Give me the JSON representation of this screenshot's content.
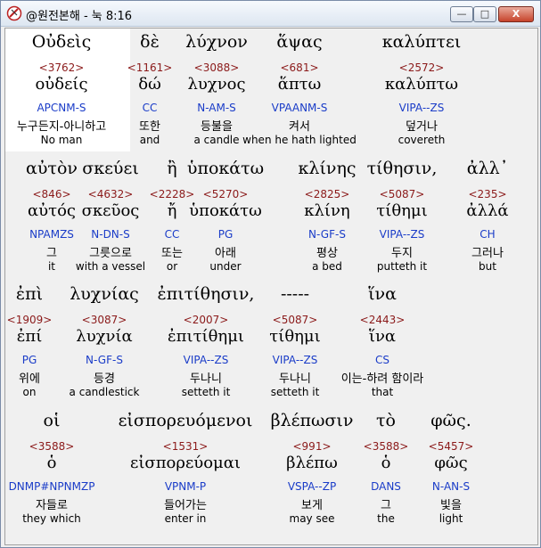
{
  "window": {
    "title": "@원전본해 - 눅 8:16",
    "minimize_label": "—",
    "maximize_label": "□",
    "close_label": "X"
  },
  "rows": [
    {
      "words": [
        {
          "greek": "Οὐδεὶς",
          "strong": "<3762>",
          "lemma": "οὐδείς",
          "parse": "APCNM-S",
          "korean": "누구든지-아니하고",
          "english": "No man"
        },
        {
          "greek": "δὲ",
          "strong": "<1161>",
          "lemma": "δώ",
          "parse": "CC",
          "korean": "또한",
          "english": "and"
        },
        {
          "greek": "λύχνον",
          "strong": "<3088>",
          "lemma": "λυχνος",
          "parse": "N-AM-S",
          "korean": "등불을",
          "english": "a candle"
        },
        {
          "greek": "ἅψας",
          "strong": "<681>",
          "lemma": "ἅπτω",
          "parse": "VPAANM-S",
          "korean": "켜서",
          "english": "when he hath lighted"
        },
        {
          "greek": "καλύπτει",
          "strong": "<2572>",
          "lemma": "καλύπτω",
          "parse": "VIPA--ZS",
          "korean": "덮거나",
          "english": "covereth"
        }
      ]
    },
    {
      "words": [
        {
          "greek": "αὐτὸν",
          "strong": "<846>",
          "lemma": "αὐτός",
          "parse": "NPAMZS",
          "korean": "그",
          "english": "it"
        },
        {
          "greek": "σκεύει",
          "strong": "<4632>",
          "lemma": "σκεῦος",
          "parse": "N-DN-S",
          "korean": "그릇으로",
          "english": "with a vessel"
        },
        {
          "greek": "ἢ",
          "strong": "<2228>",
          "lemma": "ἤ",
          "parse": "CC",
          "korean": "또는",
          "english": "or"
        },
        {
          "greek": "ὑποκάτω",
          "strong": "<5270>",
          "lemma": "ὑποκάτω",
          "parse": "PG",
          "korean": "아래",
          "english": "under"
        },
        {
          "greek": "κλίνης",
          "strong": "<2825>",
          "lemma": "κλίνη",
          "parse": "N-GF-S",
          "korean": "평상",
          "english": "a bed"
        },
        {
          "greek": "τίθησιν,",
          "strong": "<5087>",
          "lemma": "τίθημι",
          "parse": "VIPA--ZS",
          "korean": "두지",
          "english": "putteth it"
        },
        {
          "greek": "ἀλλ᾽",
          "strong": "<235>",
          "lemma": "ἀλλά",
          "parse": "CH",
          "korean": "그러나",
          "english": "but"
        }
      ]
    },
    {
      "words": [
        {
          "greek": "ἐπὶ",
          "strong": "<1909>",
          "lemma": "ἐπί",
          "parse": "PG",
          "korean": "위에",
          "english": "on"
        },
        {
          "greek": "λυχνίας",
          "strong": "<3087>",
          "lemma": "λυχνία",
          "parse": "N-GF-S",
          "korean": "등경",
          "english": "a candlestick"
        },
        {
          "greek": "ἐπιτίθησιν,",
          "strong": "<2007>",
          "lemma": "ἐπιτίθημι",
          "parse": "VIPA--ZS",
          "korean": "두나니",
          "english": "setteth it"
        },
        {
          "greek": "-----",
          "strong": "<5087>",
          "lemma": "τίθημι",
          "parse": "VIPA--ZS",
          "korean": "두나니",
          "english": "setteth it"
        },
        {
          "greek": "ἵνα",
          "strong": "<2443>",
          "lemma": "ἵνα",
          "parse": "CS",
          "korean": "이는-하려 함이라",
          "english": "that"
        }
      ]
    },
    {
      "words": [
        {
          "greek": "οἱ",
          "strong": "<3588>",
          "lemma": "ὁ",
          "parse": "DNMP#NPNMZP",
          "korean": "자들로",
          "english": "they which"
        },
        {
          "greek": "εἰσπορευόμενοι",
          "strong": "<1531>",
          "lemma": "εἰσπορεύομαι",
          "parse": "VPNM-P",
          "korean": "들어가는",
          "english": "enter in"
        },
        {
          "greek": "βλέπωσιν",
          "strong": "<991>",
          "lemma": "βλέπω",
          "parse": "VSPA--ZP",
          "korean": "보게",
          "english": "may see"
        },
        {
          "greek": "τὸ",
          "strong": "<3588>",
          "lemma": "ὁ",
          "parse": "DANS",
          "korean": "그",
          "english": "the"
        },
        {
          "greek": "φῶς.",
          "strong": "<5457>",
          "lemma": "φῶς",
          "parse": "N-AN-S",
          "korean": "빛을",
          "english": "light"
        }
      ]
    }
  ]
}
